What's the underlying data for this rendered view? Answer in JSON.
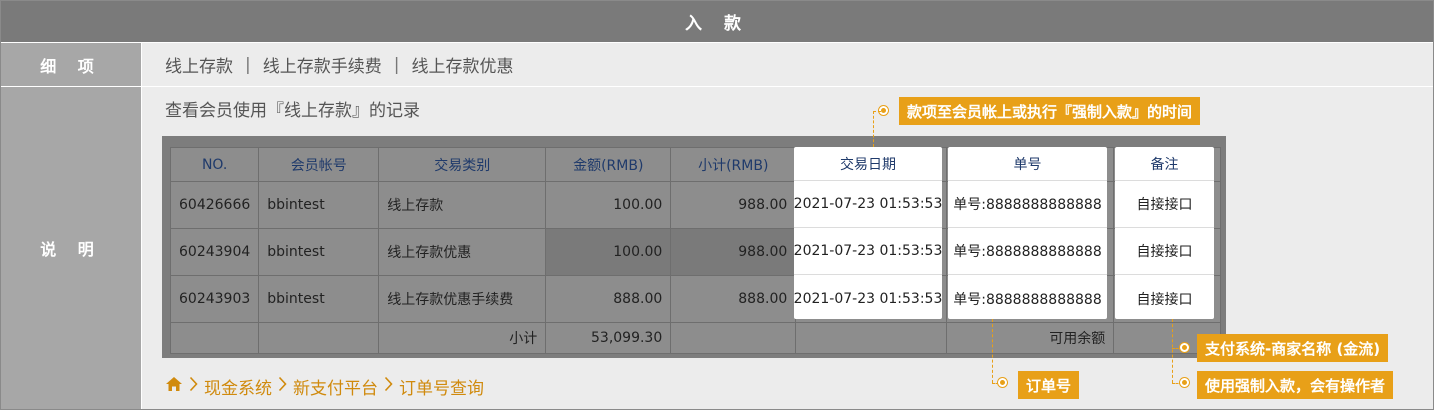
{
  "title": "入 款",
  "detail_label": "细 项",
  "description_label": "说 明",
  "detail_items": [
    "线上存款",
    "线上存款手续费",
    "线上存款优惠"
  ],
  "detail_separator": "|",
  "description": "查看会员使用『线上存款』的记录",
  "table": {
    "headers": [
      "NO.",
      "会员帐号",
      "交易类别",
      "金额(RMB)",
      "小计(RMB)",
      "交易日期",
      "单号",
      "备注"
    ],
    "rows": [
      {
        "no": "60426666",
        "account": "bbintest",
        "type": "线上存款",
        "amount": "100.00",
        "subtotal": "988.00",
        "date": "2021-07-23 01:53:53",
        "serial": "单号:8888888888888",
        "note": "自接接口"
      },
      {
        "no": "60243904",
        "account": "bbintest",
        "type": "线上存款优惠",
        "amount": "100.00",
        "subtotal": "988.00",
        "date": "2021-07-23 01:53:53",
        "serial": "单号:8888888888888",
        "note": "自接接口"
      },
      {
        "no": "60243903",
        "account": "bbintest",
        "type": "线上存款优惠手续费",
        "amount": "888.00",
        "subtotal": "888.00",
        "date": "2021-07-23 01:53:53",
        "serial": "单号:8888888888888",
        "note": "自接接口"
      }
    ],
    "subtotal_label": "小计",
    "subtotal_value": "53,099.30",
    "available_label": "可用余额"
  },
  "breadcrumb": [
    "现金系统",
    "新支付平台",
    "订单号查询"
  ],
  "icons": {
    "home": "home-icon",
    "chevron": "chevron-right-icon"
  },
  "callouts": {
    "date": "款项至会员帐上或执行『强制入款』的时间",
    "order": "订单号",
    "merchant": "支付系统-商家名称 (金流)",
    "operator": "使用强制入款，会有操作者"
  },
  "colors": {
    "accent": "#e8a018",
    "header_bar": "#7a7a7a",
    "label_col": "#a7a7a7",
    "body_bg": "#ececec",
    "table_overlay": "#7d7d7d"
  }
}
